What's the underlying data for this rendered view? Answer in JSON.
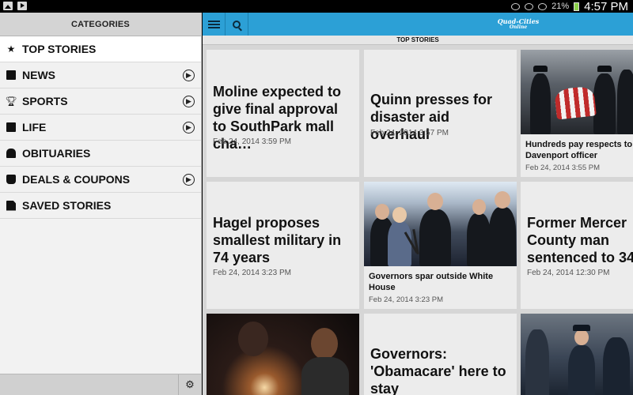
{
  "status_bar": {
    "battery": "21%",
    "time": "4:57 PM"
  },
  "sidebar": {
    "header": "CATEGORIES",
    "items": [
      {
        "label": "TOP STORIES",
        "icon": "star-icon",
        "has_arrow": false,
        "active": true
      },
      {
        "label": "NEWS",
        "icon": "newspaper-icon",
        "has_arrow": true
      },
      {
        "label": "SPORTS",
        "icon": "trophy-icon",
        "has_arrow": true
      },
      {
        "label": "LIFE",
        "icon": "buildings-icon",
        "has_arrow": true
      },
      {
        "label": "OBITUARIES",
        "icon": "tombstone-icon",
        "has_arrow": false
      },
      {
        "label": "DEALS & COUPONS",
        "icon": "coupon-bag-icon",
        "has_arrow": true
      },
      {
        "label": "SAVED STORIES",
        "icon": "saved-document-icon",
        "has_arrow": false
      }
    ]
  },
  "header": {
    "logo_line1": "Quad-Cities",
    "logo_line2": "Online",
    "section_title": "TOP STORIES",
    "accent": "#2ca0d6"
  },
  "stories": [
    {
      "headline": "Moline expected to give final approval to SouthPark mall cha…",
      "date": "Feb 24, 2014 3:59 PM"
    },
    {
      "headline": "Quinn presses for disaster aid overhaul",
      "date": "Feb 24, 2014 3:57 PM"
    },
    {
      "headline": "Hundreds pay respects to Davenport officer",
      "date": "Feb 24, 2014 3:55 PM",
      "image": true
    },
    {
      "headline": "Hagel proposes smallest military in 74 years",
      "date": "Feb 24, 2014 3:23 PM"
    },
    {
      "headline": "Governors spar outside White House",
      "date": "Feb 24, 2014 3:23 PM",
      "image": true
    },
    {
      "headline": "Former Mercer County man sentenced to 34",
      "date": "Feb 24, 2014 12:30 PM"
    },
    {
      "headline": "",
      "date": "",
      "image": true
    },
    {
      "headline": "Governors: 'Obamacare' here to stay",
      "date": ""
    },
    {
      "headline": "",
      "date": "",
      "image": true
    }
  ]
}
